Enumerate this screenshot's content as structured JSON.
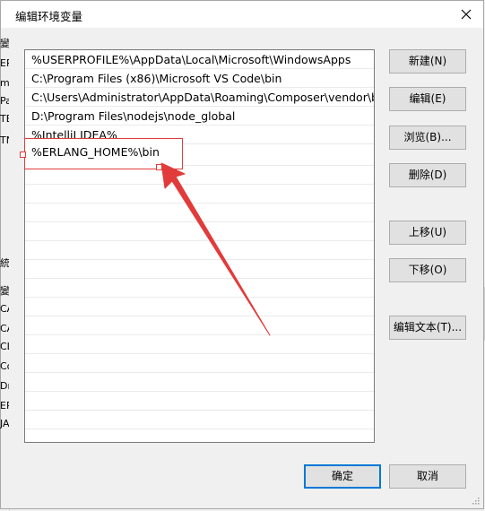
{
  "background": {
    "left_chars": [
      "變",
      "ER",
      "m",
      "Pa",
      "TE",
      "TN",
      "統",
      "變",
      "CA",
      "CA",
      "CL",
      "Co",
      "Dr",
      "ER",
      "JA"
    ]
  },
  "dialog": {
    "title": "编辑环境变量",
    "close_icon": "close-icon"
  },
  "list": {
    "items": [
      "%USERPROFILE%\\AppData\\Local\\Microsoft\\WindowsApps",
      "C:\\Program Files (x86)\\Microsoft VS Code\\bin",
      "C:\\Users\\Administrator\\AppData\\Roaming\\Composer\\vendor\\b...",
      "D:\\Program Files\\nodejs\\node_global",
      "%IntelliJ IDEA%"
    ],
    "editing_value": "%ERLANG_HOME%\\bin"
  },
  "buttons": {
    "new": "新建(N)",
    "edit": "编辑(E)",
    "browse": "浏览(B)...",
    "delete": "删除(D)",
    "move_up": "上移(U)",
    "move_down": "下移(O)",
    "edit_text": "编辑文本(T)...",
    "ok": "确定",
    "cancel": "取消"
  },
  "annotation": {
    "color": "#e23b3b"
  }
}
